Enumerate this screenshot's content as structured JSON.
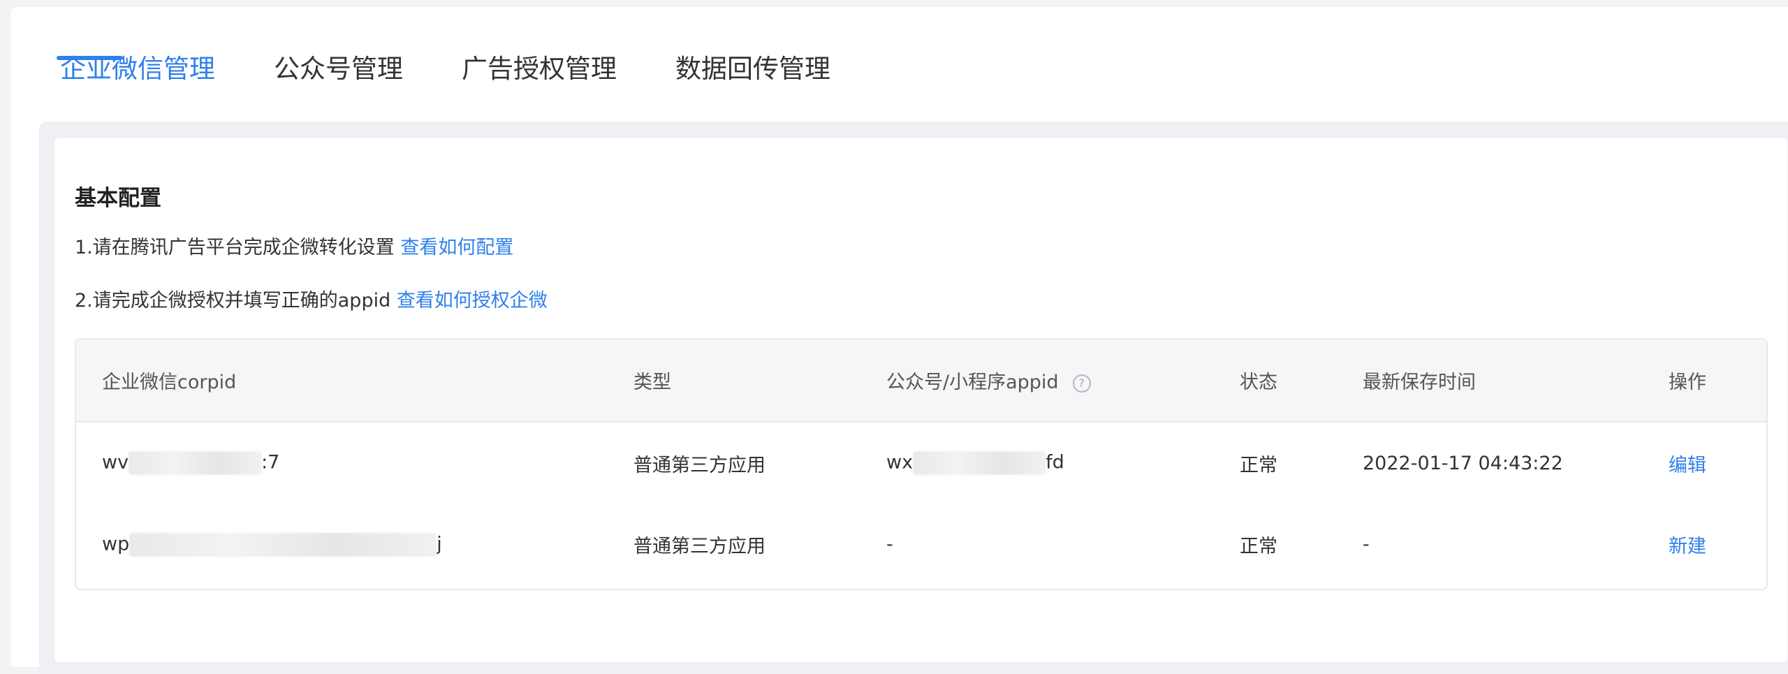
{
  "tabs": [
    {
      "label": "企业微信管理",
      "active": true
    },
    {
      "label": "公众号管理",
      "active": false
    },
    {
      "label": "广告授权管理",
      "active": false
    },
    {
      "label": "数据回传管理",
      "active": false
    }
  ],
  "section": {
    "title": "基本配置",
    "instructions": [
      {
        "text": "1.请在腾讯广告平台完成企微转化设置 ",
        "link": "查看如何配置"
      },
      {
        "text": "2.请完成企微授权并填写正确的appid ",
        "link": "查看如何授权企微"
      }
    ]
  },
  "table": {
    "headers": {
      "corpid": "企业微信corpid",
      "type": "类型",
      "appid": "公众号/小程序appid",
      "help_icon_glyph": "?",
      "status": "状态",
      "saved_time": "最新保存时间",
      "action": "操作"
    },
    "rows": [
      {
        "corpid_prefix": "wv",
        "corpid_suffix": ":7",
        "type": "普通第三方应用",
        "appid_prefix": "wx",
        "appid_suffix": "fd",
        "status": "正常",
        "saved_time": "2022-01-17 04:43:22",
        "action": "编辑"
      },
      {
        "corpid_prefix": "wp",
        "corpid_suffix": "j",
        "type": "普通第三方应用",
        "appid_prefix": "-",
        "appid_suffix": "",
        "status": "正常",
        "saved_time": "-",
        "action": "新建"
      }
    ]
  },
  "colors": {
    "accent": "#2f80ed",
    "page_bg": "#f2f3f5",
    "table_header_bg": "#f5f6f7"
  }
}
